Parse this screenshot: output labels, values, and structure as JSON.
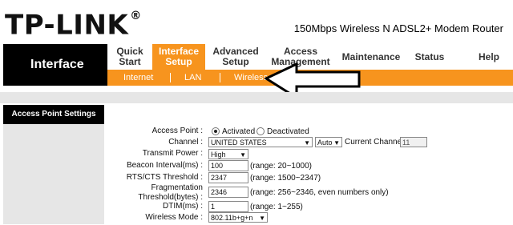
{
  "header": {
    "logo_text": "TP-LINK",
    "logo_mark": "®",
    "model": "150Mbps Wireless N ADSL2+ Modem Router"
  },
  "nav": {
    "section_title": "Interface",
    "items": [
      {
        "label": "Quick Start"
      },
      {
        "label": "Interface Setup",
        "active": true
      },
      {
        "label": "Advanced Setup"
      },
      {
        "label": "Access Management"
      },
      {
        "label": "Maintenance"
      },
      {
        "label": "Status"
      },
      {
        "label": "Help"
      }
    ],
    "sub_items": [
      "Internet",
      "LAN",
      "Wireless"
    ]
  },
  "side": {
    "title": "Access Point Settings"
  },
  "form": {
    "access_point": {
      "label": "Access Point :",
      "activated": "Activated",
      "deactivated": "Deactivated",
      "selected": "Activated"
    },
    "channel": {
      "label": "Channel :",
      "country": "UNITED STATES",
      "mode": "Auto",
      "current_label": "Current Channel:",
      "current_value": "11"
    },
    "transmit_power": {
      "label": "Transmit Power :",
      "value": "High"
    },
    "beacon": {
      "label": "Beacon Interval(ms) :",
      "value": "100",
      "range": "(range: 20~1000)"
    },
    "rts": {
      "label": "RTS/CTS Threshold :",
      "value": "2347",
      "range": "(range: 1500~2347)"
    },
    "frag": {
      "label_line1": "Fragmentation",
      "label_line2": "Threshold(bytes) :",
      "value": "2346",
      "range": "(range: 256~2346, even numbers only)"
    },
    "dtim": {
      "label": "DTIM(ms) :",
      "value": "1",
      "range": "(range: 1~255)"
    },
    "wireless_mode": {
      "label": "Wireless Mode :",
      "value": "802.11b+g+n"
    }
  },
  "colors": {
    "accent": "#f7941e",
    "nav_dark": "#000000",
    "panel_gray": "#e6e6e6"
  }
}
